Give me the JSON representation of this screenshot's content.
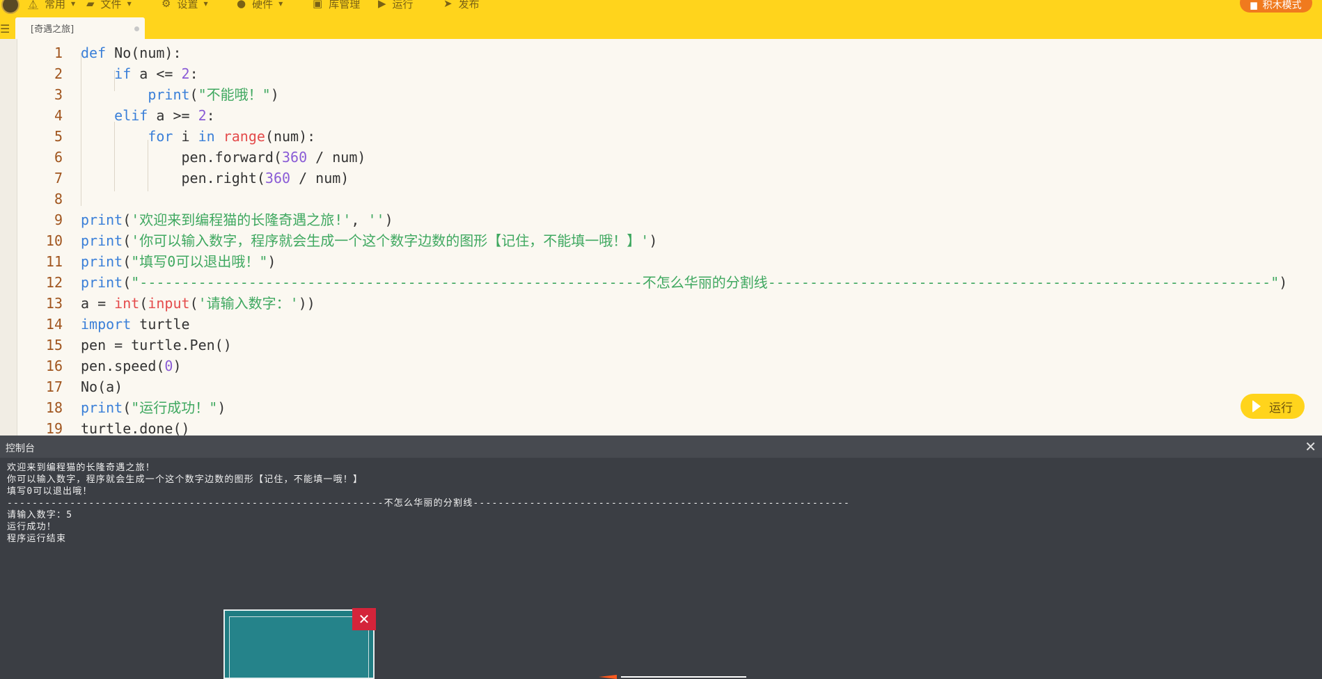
{
  "menu": {
    "items": [
      {
        "icon": "sigma-icon",
        "glyph": "⏅",
        "label": "常用"
      },
      {
        "icon": "folder-icon",
        "glyph": "▰",
        "label": "文件"
      },
      {
        "icon": "gear-icon",
        "glyph": "⚙",
        "label": "设置"
      },
      {
        "icon": "hardware-icon",
        "glyph": "●",
        "label": "硬件"
      },
      {
        "icon": "library-icon",
        "glyph": "▣",
        "label": "库管理"
      },
      {
        "icon": "play-icon",
        "glyph": "▶",
        "label": "运行"
      },
      {
        "icon": "send-icon",
        "glyph": "➤",
        "label": "发布"
      }
    ],
    "block_mode": "积木模式"
  },
  "tab": {
    "label": "[奇遇之旅]"
  },
  "code": [
    {
      "n": "1",
      "t": "def No(num):"
    },
    {
      "n": "2",
      "t": "    if a <= 2:"
    },
    {
      "n": "3",
      "t": "        print(\"不能哦！\")"
    },
    {
      "n": "4",
      "t": "    elif a >= 2:"
    },
    {
      "n": "5",
      "t": "        for i in range(num):"
    },
    {
      "n": "6",
      "t": "            pen.forward(360 / num)"
    },
    {
      "n": "7",
      "t": "            pen.right(360 / num)"
    },
    {
      "n": "8",
      "t": ""
    },
    {
      "n": "9",
      "t": "print('欢迎来到编程猫的长隆奇遇之旅!', '')"
    },
    {
      "n": "10",
      "t": "print('你可以输入数字，程序就会生成一个这个数字边数的图形【记住，不能填一哦！】')"
    },
    {
      "n": "11",
      "t": "print(\"填写0可以退出哦！\")"
    },
    {
      "n": "12",
      "t": "print(\"------------------------------------------------------------不怎么华丽的分割线------------------------------------------------------------\")"
    },
    {
      "n": "13",
      "t": "a = int(input('请输入数字：'))"
    },
    {
      "n": "14",
      "t": "import turtle"
    },
    {
      "n": "15",
      "t": "pen = turtle.Pen()"
    },
    {
      "n": "16",
      "t": "pen.speed(0)"
    },
    {
      "n": "17",
      "t": "No(a)"
    },
    {
      "n": "18",
      "t": "print(\"运行成功！\")"
    },
    {
      "n": "19",
      "t": "turtle.done()"
    }
  ],
  "run_button": {
    "label": "运行"
  },
  "console": {
    "title": "控制台",
    "lines": [
      "欢迎来到编程猫的长隆奇遇之旅！",
      "你可以输入数字，程序就会生成一个这个数字边数的图形【记住，不能填一哦！】",
      "填写0可以退出哦！",
      "------------------------------------------------------------不怎么华丽的分割线------------------------------------------------------------",
      "请输入数字：5",
      "运行成功！",
      "程序运行结束"
    ]
  },
  "colors": {
    "menubar": "#ffd41c",
    "keyword": "#3a7fd8",
    "builtin": "#e44b4b",
    "number": "#8a5cd6",
    "string": "#3fa860",
    "line_number": "#a0551e",
    "console_bg": "#3b3e44",
    "turtle_bg": "#1f7c82"
  }
}
